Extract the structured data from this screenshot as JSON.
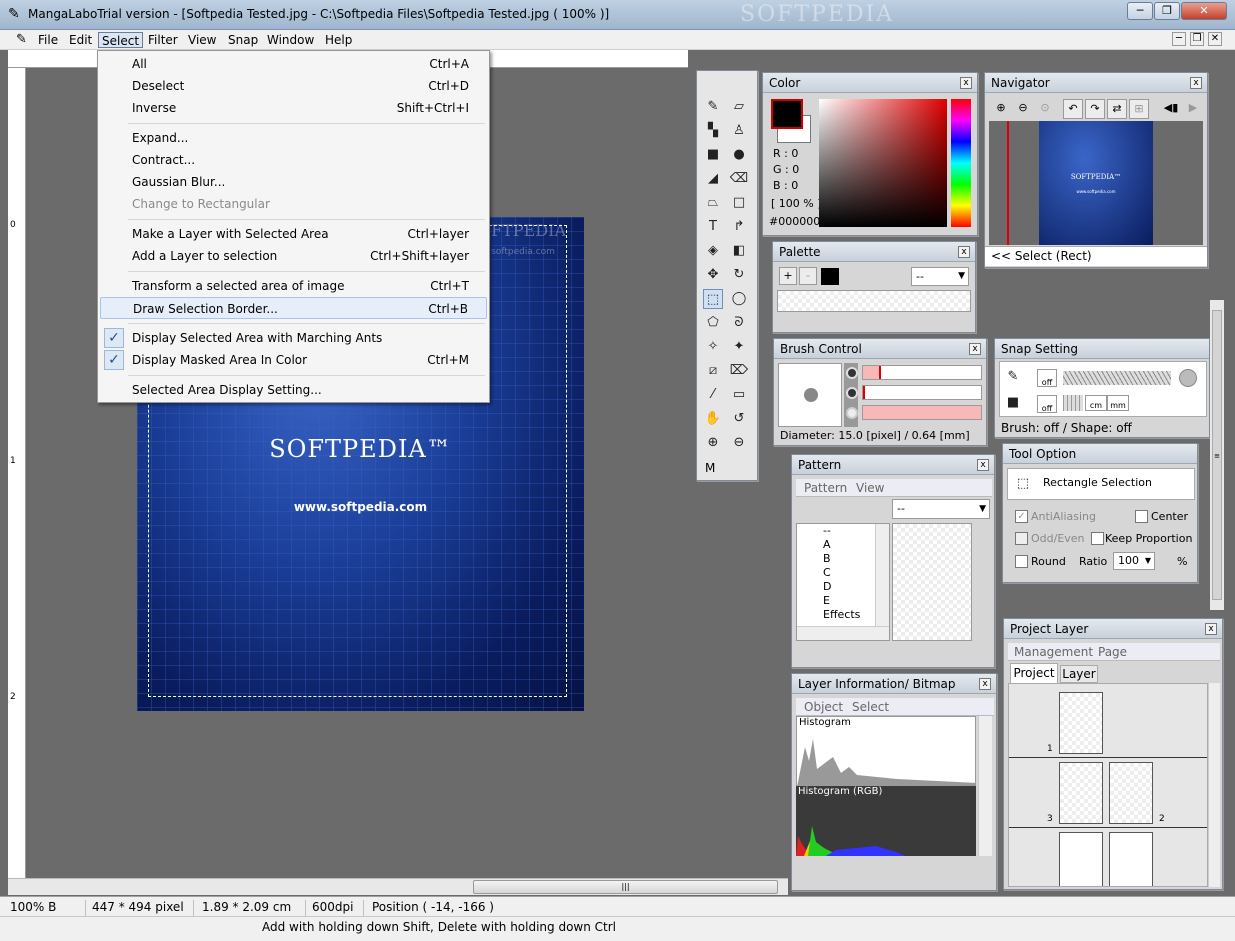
{
  "window": {
    "title": "MangaLaboTrial version - [Softpedia Tested.jpg - C:\\Softpedia Files\\Softpedia Tested.jpg ( 100% )]",
    "watermark": "SOFTPEDIA",
    "minimize": "─",
    "restore": "❐",
    "close": "✕"
  },
  "menu": [
    "File",
    "Edit",
    "Select",
    "Filter",
    "View",
    "Snap",
    "Window",
    "Help"
  ],
  "ruler": {
    "marks": [
      "0",
      "1",
      "2"
    ]
  },
  "image": {
    "logo": "SOFTPEDIA™",
    "url": "www.softpedia.com",
    "wm": "SOFTPEDIA",
    "wm_url": "www.softpedia.com"
  },
  "select_menu": [
    {
      "label": "All",
      "shortcut": "Ctrl+A"
    },
    {
      "label": "Deselect",
      "shortcut": "Ctrl+D"
    },
    {
      "label": "Inverse",
      "shortcut": "Shift+Ctrl+I"
    },
    {
      "label": "Expand...",
      "shortcut": ""
    },
    {
      "label": "Contract...",
      "shortcut": ""
    },
    {
      "label": "Gaussian Blur...",
      "shortcut": ""
    },
    {
      "label": "Change to Rectangular",
      "shortcut": ""
    },
    {
      "label": "Make a Layer with Selected Area",
      "shortcut": "Ctrl+layer"
    },
    {
      "label": "Add a Layer to selection",
      "shortcut": "Ctrl+Shift+layer"
    },
    {
      "label": "Transform a selected area of image",
      "shortcut": "Ctrl+T"
    },
    {
      "label": "Draw Selection Border...",
      "shortcut": "Ctrl+B"
    },
    {
      "label": "Display Selected Area with Marching Ants",
      "shortcut": ""
    },
    {
      "label": "Display Masked Area In Color",
      "shortcut": "Ctrl+M"
    },
    {
      "label": "Selected Area Display Setting...",
      "shortcut": ""
    }
  ],
  "toolbox": {
    "mode": "M"
  },
  "color": {
    "title": "Color",
    "r": "R : 0",
    "g": "G : 0",
    "b": "B : 0",
    "pct": "[ 100 % ]",
    "hex": "#000000"
  },
  "navigator": {
    "title": "Navigator",
    "status": "<< Select (Rect)",
    "thumb_logo": "SOFTPEDIA™",
    "thumb_url": "www.softpedia.com"
  },
  "palette": {
    "title": "Palette",
    "select": "--"
  },
  "brush": {
    "title": "Brush Control",
    "diameter": "Diameter: 15.0 [pixel] / 0.64 [mm]"
  },
  "snap": {
    "title": "Snap Setting",
    "off1": "off",
    "off2": "off",
    "cm": "cm",
    "mm": "mm",
    "status": "Brush: off / Shape: off"
  },
  "pattern": {
    "title": "Pattern",
    "tabs": [
      "Pattern",
      "View"
    ],
    "select": "--",
    "tree": [
      "--",
      "A",
      "B",
      "C",
      "D",
      "E",
      "Effects"
    ]
  },
  "tool_option": {
    "title": "Tool Option",
    "mode": "Rectangle Selection",
    "antialiasing": "AntiAliasing",
    "center": "Center",
    "odd_even": "Odd/Even",
    "keep": "Keep Proportion",
    "round": "Round",
    "ratio": "Ratio",
    "ratio_val": "100",
    "pct": "%"
  },
  "layer_info": {
    "title": "Layer Information/ Bitmap",
    "tabs": [
      "Object",
      "Select"
    ],
    "hist": "Histogram",
    "hist_rgb": "Histogram (RGB)"
  },
  "project_layer": {
    "title": "Project Layer",
    "menu": [
      "Management",
      "Page"
    ],
    "tabs": [
      "Project",
      "Layer"
    ],
    "pages": [
      "1",
      "3",
      "2"
    ]
  },
  "status": {
    "zoom": "100% B",
    "size": "447 * 494 pixel",
    "cm": "1.89 * 2.09 cm",
    "dpi": "600dpi",
    "pos": "Position ( -14, -166 )",
    "hint": "Add with holding down Shift, Delete with holding down Ctrl"
  }
}
